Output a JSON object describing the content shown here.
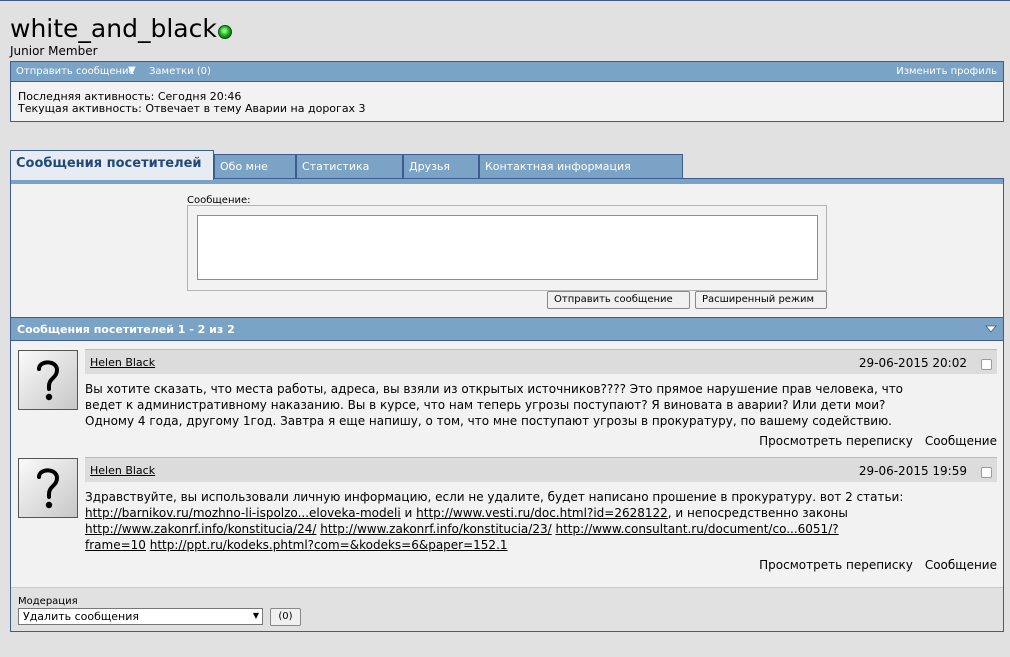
{
  "profile": {
    "username": "white_and_black",
    "user_title": "Junior Member",
    "status_color": "#1db41d"
  },
  "profile_bar": {
    "send_message": "Отправить сообщение",
    "notes": "Заметки (0)",
    "edit_profile": "Изменить профиль"
  },
  "activity": {
    "last": "Последняя активность: Сегодня 20:46",
    "current": "Текущая активность: Отвечает в тему Аварии на дорогах 3"
  },
  "tabs": [
    {
      "label": "Сообщения посетителей"
    },
    {
      "label": "Обо мне"
    },
    {
      "label": "Статистика"
    },
    {
      "label": "Друзья"
    },
    {
      "label": "Контактная информация"
    }
  ],
  "compose": {
    "label": "Сообщение:",
    "value": "",
    "send_button": "Отправить сообщение",
    "advanced_button": "Расширенный режим"
  },
  "visitor_messages": {
    "header": "Сообщения посетителей 1 - 2 из 2"
  },
  "posts": [
    {
      "author": "Helen Black",
      "date": "29-06-2015 20:02",
      "text_lines": [
        "Вы хотите сказать, что места работы, адреса, вы взяли из открытых источников???? Это прямое нарушение прав человека, что",
        "ведет к административному наказанию. Вы в курсе, что нам теперь угрозы поступают? Я виновата в аварии? Или дети мои?",
        "Одному 4 года, другому 1год. Завтра я еще напишу, о том, что мне поступают угрозы в прокуратуру, по вашему содействию."
      ],
      "view_conversation": "Просмотреть переписку",
      "message": "Сообщение"
    },
    {
      "author": "Helen Black",
      "date": "29-06-2015 19:59",
      "text": "Здравствуйте, вы использовали личную информацию, если не удалите, будет написано прошение в прокуратуру. вот 2 статьи:",
      "link1": "http://barnikov.ru/mozhno-li-ispolzo...eloveka-modeli",
      "and": "и",
      "link2": "http://www.vesti.ru/doc.html?id=2628122",
      "tail": ", и непосредственно законы",
      "link3": "http://www.zakonrf.info/konstitucia/24/",
      "link4": "http://www.zakonrf.info/konstitucia/23/",
      "link5a": "http://www.consultant.ru/document/co...6051/?",
      "link5b": "frame=10",
      "link6": "http://ppt.ru/kodeks.phtml?com=&kodeks=6&paper=152.1",
      "view_conversation": "Просмотреть переписку",
      "message": "Сообщение"
    }
  ],
  "moderation": {
    "label": "Модерация",
    "selected": "Удалить сообщения",
    "count_button": "(0)"
  },
  "colors": {
    "bar": "#7ba3c6",
    "border": "#3e5c92",
    "background": "#e1e1e2",
    "panel": "#f2f2f2"
  }
}
